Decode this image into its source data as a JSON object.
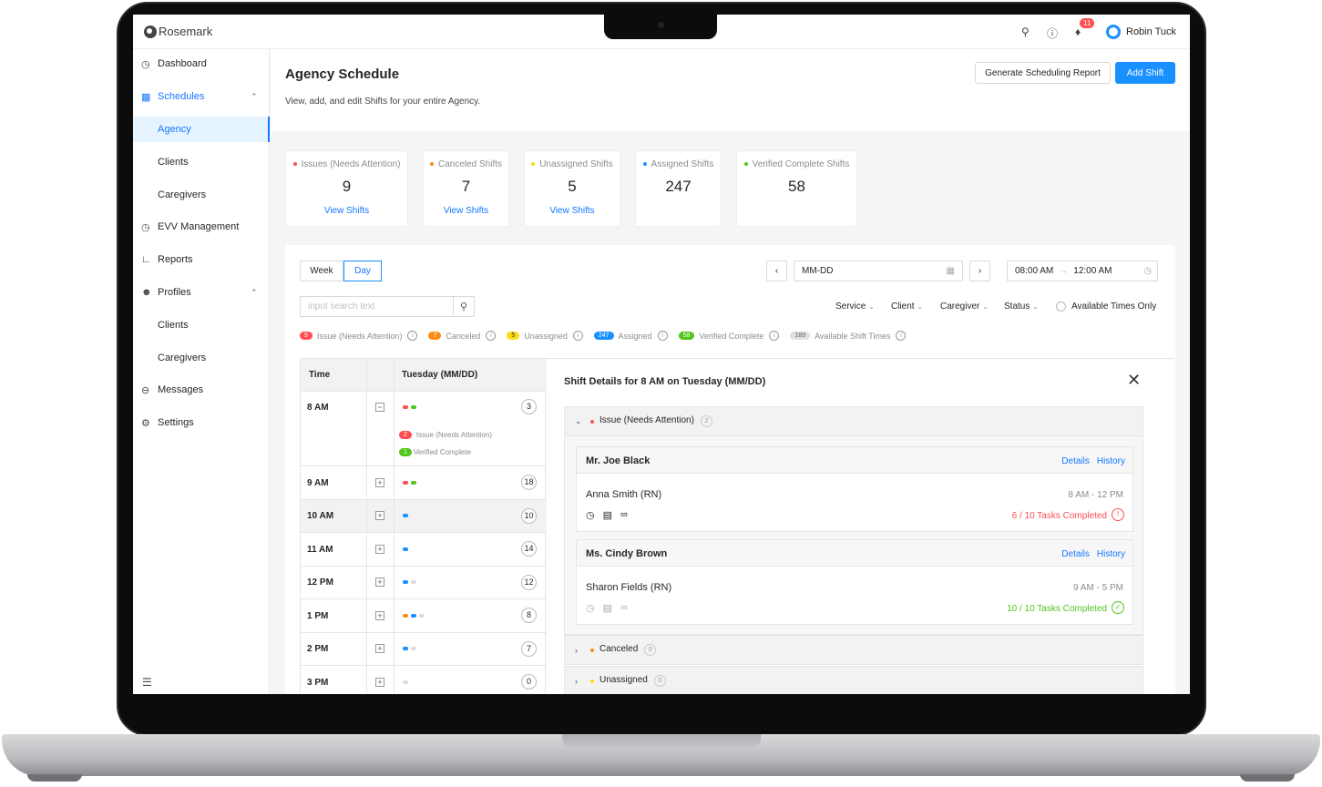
{
  "app": {
    "brand": "Rosemark",
    "user": "Robin Tuck",
    "notifications": "11"
  },
  "sidebar": {
    "items": [
      {
        "label": "Dashboard",
        "icon": "dashboard-icon"
      },
      {
        "label": "Schedules",
        "icon": "calendar-icon"
      },
      {
        "label": "Agency"
      },
      {
        "label": "Clients"
      },
      {
        "label": "Caregivers"
      },
      {
        "label": "EVV Management",
        "icon": "clock-icon"
      },
      {
        "label": "Reports",
        "icon": "chart-icon"
      },
      {
        "label": "Profiles",
        "icon": "user-icon"
      },
      {
        "label": "Clients"
      },
      {
        "label": "Caregivers"
      },
      {
        "label": "Messages",
        "icon": "message-icon"
      },
      {
        "label": "Settings",
        "icon": "gear-icon"
      }
    ]
  },
  "page": {
    "title": "Agency Schedule",
    "subtitle": "View, add, and edit Shifts for your entire Agency.",
    "report_button": "Generate Scheduling Report",
    "add_button": "Add Shift"
  },
  "cards": [
    {
      "label": "Issues (Needs Attention)",
      "value": "9",
      "link": "View Shifts",
      "color": "#ff4d4f"
    },
    {
      "label": "Canceled Shifts",
      "value": "7",
      "link": "View Shifts",
      "color": "#fa8c16"
    },
    {
      "label": "Unassigned Shifts",
      "value": "5",
      "link": "View Shifts",
      "color": "#fadb14"
    },
    {
      "label": "Assigned Shifts",
      "value": "247",
      "link": "",
      "color": "#1890ff"
    },
    {
      "label": "Verified Complete Shifts",
      "value": "58",
      "link": "",
      "color": "#52c41a"
    }
  ],
  "controls": {
    "week": "Week",
    "day": "Day",
    "date_placeholder": "MM-DD",
    "time_start": "08:00 AM",
    "time_end": "12:00 AM",
    "search_placeholder": "input search text",
    "filters": [
      "Service",
      "Client",
      "Caregiver",
      "Status"
    ],
    "available_only": "Available Times Only"
  },
  "legend": [
    {
      "count": "9",
      "label": "Issue (Needs Attention)",
      "color": "#ff4d4f"
    },
    {
      "count": "7",
      "label": "Canceled",
      "color": "#fa8c16"
    },
    {
      "count": "5",
      "label": "Unassigned",
      "color": "#fadb14"
    },
    {
      "count": "247",
      "label": "Assigned",
      "color": "#1890ff"
    },
    {
      "count": "58",
      "label": "Verified Complete",
      "color": "#52c41a"
    },
    {
      "count": "189",
      "label": "Available Shift Times",
      "color": "#e0e0e0"
    }
  ],
  "schedule": {
    "col_time": "Time",
    "col_day": "Tuesday (MM/DD)",
    "rows": [
      {
        "time": "8 AM",
        "count": "3",
        "toggle": "−"
      },
      {
        "time": "9 AM",
        "count": "18",
        "toggle": "+"
      },
      {
        "time": "10 AM",
        "count": "10",
        "toggle": "+"
      },
      {
        "time": "11 AM",
        "count": "14",
        "toggle": "+"
      },
      {
        "time": "12 PM",
        "count": "12",
        "toggle": "+"
      },
      {
        "time": "1 PM",
        "count": "8",
        "toggle": "+"
      },
      {
        "time": "2 PM",
        "count": "7",
        "toggle": "+"
      },
      {
        "time": "3 PM",
        "count": "0",
        "toggle": "+"
      }
    ],
    "expanded": [
      {
        "count": "2",
        "label": "Issue (Needs Attention)"
      },
      {
        "count": "1",
        "label": "Verified Complete"
      }
    ]
  },
  "details": {
    "title": "Shift Details for 8 AM on Tuesday (MM/DD)",
    "groups": [
      {
        "label": "Issue (Needs Attention)",
        "count": "2"
      },
      {
        "label": "Canceled",
        "count": "0"
      },
      {
        "label": "Unassigned",
        "count": "0"
      }
    ],
    "shifts": [
      {
        "client": "Mr. Joe Black",
        "caregiver": "Anna Smith (RN)",
        "time": "8 AM - 12 PM",
        "tasks": "6 / 10 Tasks Completed",
        "details": "Details",
        "history": "History",
        "status_color": "#ff4d4f"
      },
      {
        "client": "Ms. Cindy Brown",
        "caregiver": "Sharon Fields (RN)",
        "time": "9 AM - 5 PM",
        "tasks": "10 / 10 Tasks Completed",
        "details": "Details",
        "history": "History",
        "status_color": "#52c41a"
      }
    ]
  }
}
